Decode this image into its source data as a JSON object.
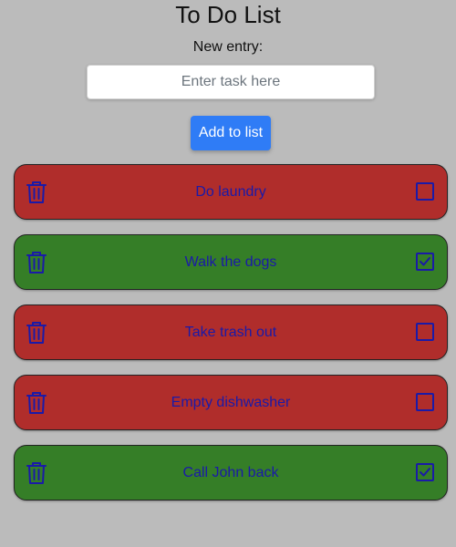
{
  "header": {
    "title": "To Do List",
    "entry_label": "New entry:"
  },
  "form": {
    "input_placeholder": "Enter task here",
    "input_value": "",
    "add_button_label": "Add to list"
  },
  "colors": {
    "background": "#bbbbbb",
    "pending": "#b02d2b",
    "done": "#357e27",
    "task_text": "#1a1aa8",
    "button": "#2f7cf6"
  },
  "icons": {
    "delete": "trash-icon",
    "checkbox": "checkbox-icon"
  },
  "tasks": [
    {
      "text": "Do laundry",
      "completed": false
    },
    {
      "text": "Walk the dogs",
      "completed": true
    },
    {
      "text": "Take trash out",
      "completed": false
    },
    {
      "text": "Empty dishwasher",
      "completed": false
    },
    {
      "text": "Call John back",
      "completed": true
    }
  ]
}
